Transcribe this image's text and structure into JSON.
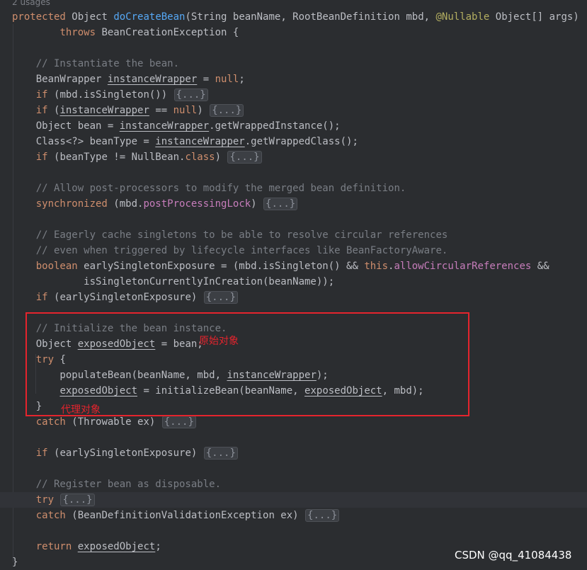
{
  "usages": "2 usages",
  "lines": [
    {
      "segs": [
        [
          "kw",
          "protected "
        ],
        [
          "",
          "Object "
        ],
        [
          "fn",
          "doCreateBean"
        ],
        [
          "",
          "(String beanName, RootBeanDefinition mbd, "
        ],
        [
          "ann",
          "@Nullable"
        ],
        [
          "",
          " Object[] args)"
        ]
      ]
    },
    {
      "segs": [
        [
          "",
          "        "
        ],
        [
          "kw",
          "throws "
        ],
        [
          "",
          "BeanCreationException {"
        ]
      ]
    },
    {
      "segs": []
    },
    {
      "segs": [
        [
          "",
          "    "
        ],
        [
          "cm",
          "// Instantiate the bean."
        ]
      ]
    },
    {
      "segs": [
        [
          "",
          "    BeanWrapper "
        ],
        [
          "var",
          "instanceWrapper"
        ],
        [
          "",
          " = "
        ],
        [
          "kw",
          "null"
        ],
        [
          "",
          ";"
        ]
      ]
    },
    {
      "segs": [
        [
          "",
          "    "
        ],
        [
          "kw",
          "if "
        ],
        [
          "",
          "(mbd.isSingleton()) "
        ],
        [
          "fold",
          "{...}"
        ]
      ]
    },
    {
      "segs": [
        [
          "",
          "    "
        ],
        [
          "kw",
          "if "
        ],
        [
          "",
          "("
        ],
        [
          "var",
          "instanceWrapper"
        ],
        [
          "",
          " == "
        ],
        [
          "kw",
          "null"
        ],
        [
          "",
          ") "
        ],
        [
          "fold",
          "{...}"
        ]
      ]
    },
    {
      "segs": [
        [
          "",
          "    Object bean = "
        ],
        [
          "var",
          "instanceWrapper"
        ],
        [
          "",
          ".getWrappedInstance();"
        ]
      ]
    },
    {
      "segs": [
        [
          "",
          "    Class<?> beanType = "
        ],
        [
          "var",
          "instanceWrapper"
        ],
        [
          "",
          ".getWrappedClass();"
        ]
      ]
    },
    {
      "segs": [
        [
          "",
          "    "
        ],
        [
          "kw",
          "if "
        ],
        [
          "",
          "(beanType != NullBean."
        ],
        [
          "kw",
          "class"
        ],
        [
          "",
          ") "
        ],
        [
          "fold",
          "{...}"
        ]
      ]
    },
    {
      "segs": []
    },
    {
      "segs": [
        [
          "",
          "    "
        ],
        [
          "cm",
          "// Allow post-processors to modify the merged bean definition."
        ]
      ]
    },
    {
      "segs": [
        [
          "",
          "    "
        ],
        [
          "kw",
          "synchronized "
        ],
        [
          "",
          "(mbd."
        ],
        [
          "fld",
          "postProcessingLock"
        ],
        [
          "",
          ") "
        ],
        [
          "fold",
          "{...}"
        ]
      ]
    },
    {
      "segs": []
    },
    {
      "segs": [
        [
          "",
          "    "
        ],
        [
          "cm",
          "// Eagerly cache singletons to be able to resolve circular references"
        ]
      ]
    },
    {
      "segs": [
        [
          "",
          "    "
        ],
        [
          "cm",
          "// even when triggered by lifecycle interfaces like BeanFactoryAware."
        ]
      ]
    },
    {
      "segs": [
        [
          "",
          "    "
        ],
        [
          "kw",
          "boolean "
        ],
        [
          "",
          "earlySingletonExposure = (mbd.isSingleton() && "
        ],
        [
          "kw",
          "this"
        ],
        [
          "",
          "."
        ],
        [
          "fld",
          "allowCircularReferences"
        ],
        [
          "",
          " &&"
        ]
      ]
    },
    {
      "segs": [
        [
          "",
          "            isSingletonCurrentlyInCreation(beanName));"
        ]
      ]
    },
    {
      "segs": [
        [
          "",
          "    "
        ],
        [
          "kw",
          "if "
        ],
        [
          "",
          "(earlySingletonExposure) "
        ],
        [
          "fold",
          "{...}"
        ]
      ]
    },
    {
      "segs": []
    },
    {
      "segs": [
        [
          "",
          "    "
        ],
        [
          "cm",
          "// Initialize the bean instance."
        ]
      ]
    },
    {
      "segs": [
        [
          "",
          "    Object "
        ],
        [
          "var",
          "exposedObject"
        ],
        [
          "",
          " = bean;"
        ]
      ]
    },
    {
      "segs": [
        [
          "",
          "    "
        ],
        [
          "kw",
          "try "
        ],
        [
          "",
          "{"
        ]
      ]
    },
    {
      "segs": [
        [
          "",
          "        populateBean(beanName, mbd, "
        ],
        [
          "var",
          "instanceWrapper"
        ],
        [
          "",
          ");"
        ]
      ]
    },
    {
      "segs": [
        [
          "",
          "        "
        ],
        [
          "var",
          "exposedObject"
        ],
        [
          "",
          " = initializeBean(beanName, "
        ],
        [
          "var",
          "exposedObject"
        ],
        [
          "",
          ", mbd);"
        ]
      ]
    },
    {
      "segs": [
        [
          "",
          "    }"
        ]
      ]
    },
    {
      "segs": [
        [
          "",
          "    "
        ],
        [
          "kw",
          "catch "
        ],
        [
          "",
          "(Throwable ex) "
        ],
        [
          "fold",
          "{...}"
        ]
      ]
    },
    {
      "segs": []
    },
    {
      "segs": [
        [
          "",
          "    "
        ],
        [
          "kw",
          "if "
        ],
        [
          "",
          "(earlySingletonExposure) "
        ],
        [
          "fold",
          "{...}"
        ]
      ]
    },
    {
      "segs": []
    },
    {
      "segs": [
        [
          "",
          "    "
        ],
        [
          "cm",
          "// Register bean as disposable."
        ]
      ]
    },
    {
      "segs": [
        [
          "",
          "    "
        ],
        [
          "kw",
          "try "
        ],
        [
          "fold",
          "{...}"
        ]
      ]
    },
    {
      "segs": [
        [
          "",
          "    "
        ],
        [
          "kw",
          "catch "
        ],
        [
          "",
          "(BeanDefinitionValidationException ex) "
        ],
        [
          "fold",
          "{...}"
        ]
      ]
    },
    {
      "segs": []
    },
    {
      "segs": [
        [
          "",
          "    "
        ],
        [
          "kw",
          "return "
        ],
        [
          "var",
          "exposedObject"
        ],
        [
          "",
          ";"
        ]
      ]
    },
    {
      "segs": [
        [
          "",
          "}"
        ]
      ]
    }
  ],
  "annotations": {
    "original_object": "原始对象",
    "proxy_object": "代理对象"
  },
  "watermark": "CSDN @qq_41084438",
  "colors": {
    "background": "#2b2d30",
    "keyword": "#cf8e6d",
    "function": "#56a8f5",
    "annotation": "#b3ae60",
    "comment": "#7a7e85",
    "field": "#c77dbb",
    "highlight_box": "#e5242d"
  }
}
